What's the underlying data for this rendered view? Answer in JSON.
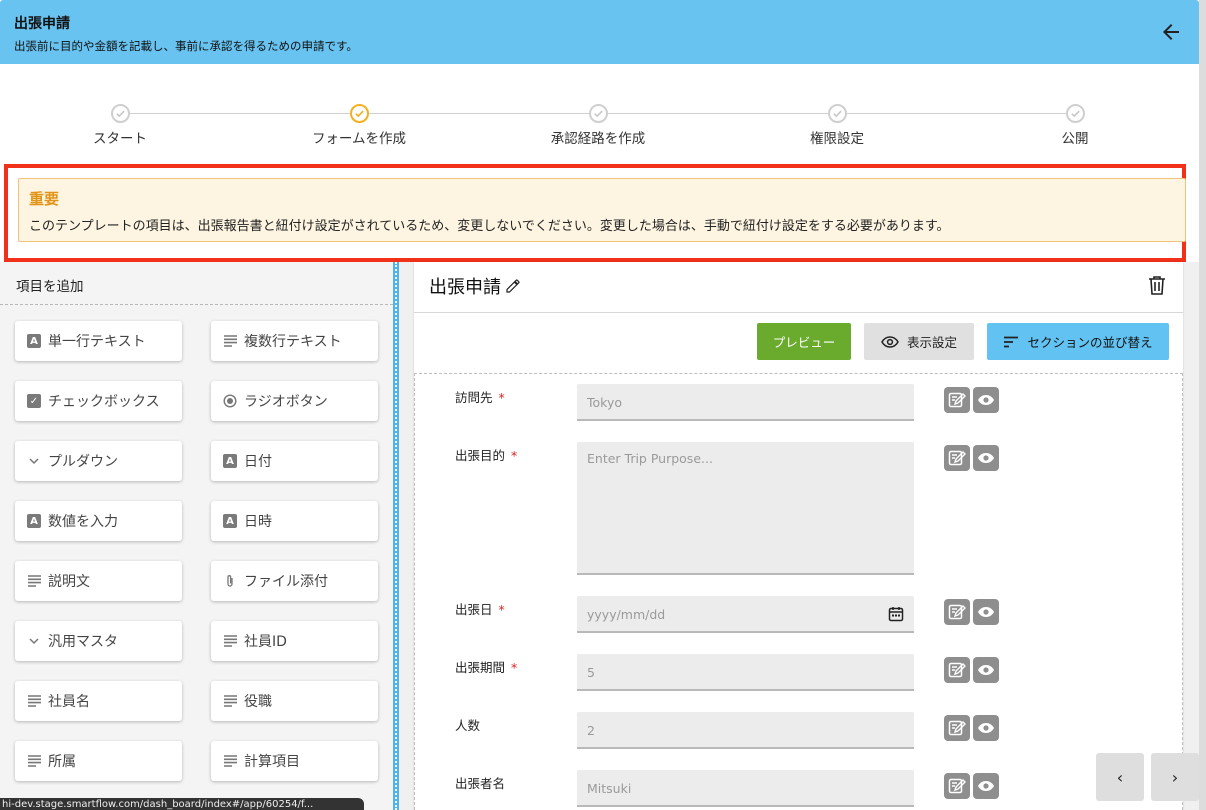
{
  "header": {
    "title": "出張申請",
    "subtitle": "出張前に目的や金額を記載し、事前に承認を得るための申請です。",
    "back_icon": "arrow-left-icon"
  },
  "stepper": {
    "steps": [
      {
        "label": "スタート",
        "state": "done"
      },
      {
        "label": "フォームを作成",
        "state": "active"
      },
      {
        "label": "承認経路を作成",
        "state": "done"
      },
      {
        "label": "権限設定",
        "state": "done"
      },
      {
        "label": "公開",
        "state": "done"
      }
    ]
  },
  "alert": {
    "title": "重要",
    "body": "このテンプレートの項目は、出張報告書と紐付け設定がされているため、変更しないでください。変更した場合は、手動で紐付け設定をする必要があります。"
  },
  "palette": {
    "title": "項目を追加",
    "items": [
      {
        "label": "単一行テキスト",
        "icon": "text-field-icon"
      },
      {
        "label": "複数行テキスト",
        "icon": "multiline-icon"
      },
      {
        "label": "チェックボックス",
        "icon": "checkbox-icon"
      },
      {
        "label": "ラジオボタン",
        "icon": "radio-icon"
      },
      {
        "label": "プルダウン",
        "icon": "chevron-down-icon"
      },
      {
        "label": "日付",
        "icon": "text-field-icon"
      },
      {
        "label": "数値を入力",
        "icon": "text-field-icon"
      },
      {
        "label": "日時",
        "icon": "text-field-icon"
      },
      {
        "label": "説明文",
        "icon": "multiline-icon"
      },
      {
        "label": "ファイル添付",
        "icon": "paperclip-icon"
      },
      {
        "label": "汎用マスタ",
        "icon": "chevron-down-icon"
      },
      {
        "label": "社員ID",
        "icon": "multiline-icon"
      },
      {
        "label": "社員名",
        "icon": "multiline-icon"
      },
      {
        "label": "役職",
        "icon": "multiline-icon"
      },
      {
        "label": "所属",
        "icon": "multiline-icon"
      },
      {
        "label": "計算項目",
        "icon": "multiline-icon"
      }
    ]
  },
  "form": {
    "title": "出張申請",
    "buttons": {
      "preview": "プレビュー",
      "display": "表示設定",
      "sort": "セクションの並び替え"
    },
    "fields": [
      {
        "label": "訪問先",
        "required": true,
        "placeholder": "Tokyo"
      },
      {
        "label": "出張目的",
        "required": true,
        "placeholder": "Enter Trip Purpose..."
      },
      {
        "label": "出張日",
        "required": true,
        "placeholder": "yyyy/mm/dd"
      },
      {
        "label": "出張期間",
        "required": true,
        "placeholder": "5"
      },
      {
        "label": "人数",
        "required": false,
        "placeholder": "2"
      },
      {
        "label": "出張者名",
        "required": false,
        "placeholder": "Mitsuki"
      }
    ],
    "required_mark": "*"
  },
  "nav": {
    "prev": "‹",
    "next": "›"
  },
  "status_bar": {
    "url": "hi-dev.stage.smartflow.com/dash_board/index#/app/60254/f..."
  },
  "colors": {
    "header_bg": "#68c3f1",
    "alert_border": "#f2311a",
    "preview_btn": "#6aab2e",
    "sort_btn": "#62c2f1",
    "active_step": "#f3b020"
  }
}
